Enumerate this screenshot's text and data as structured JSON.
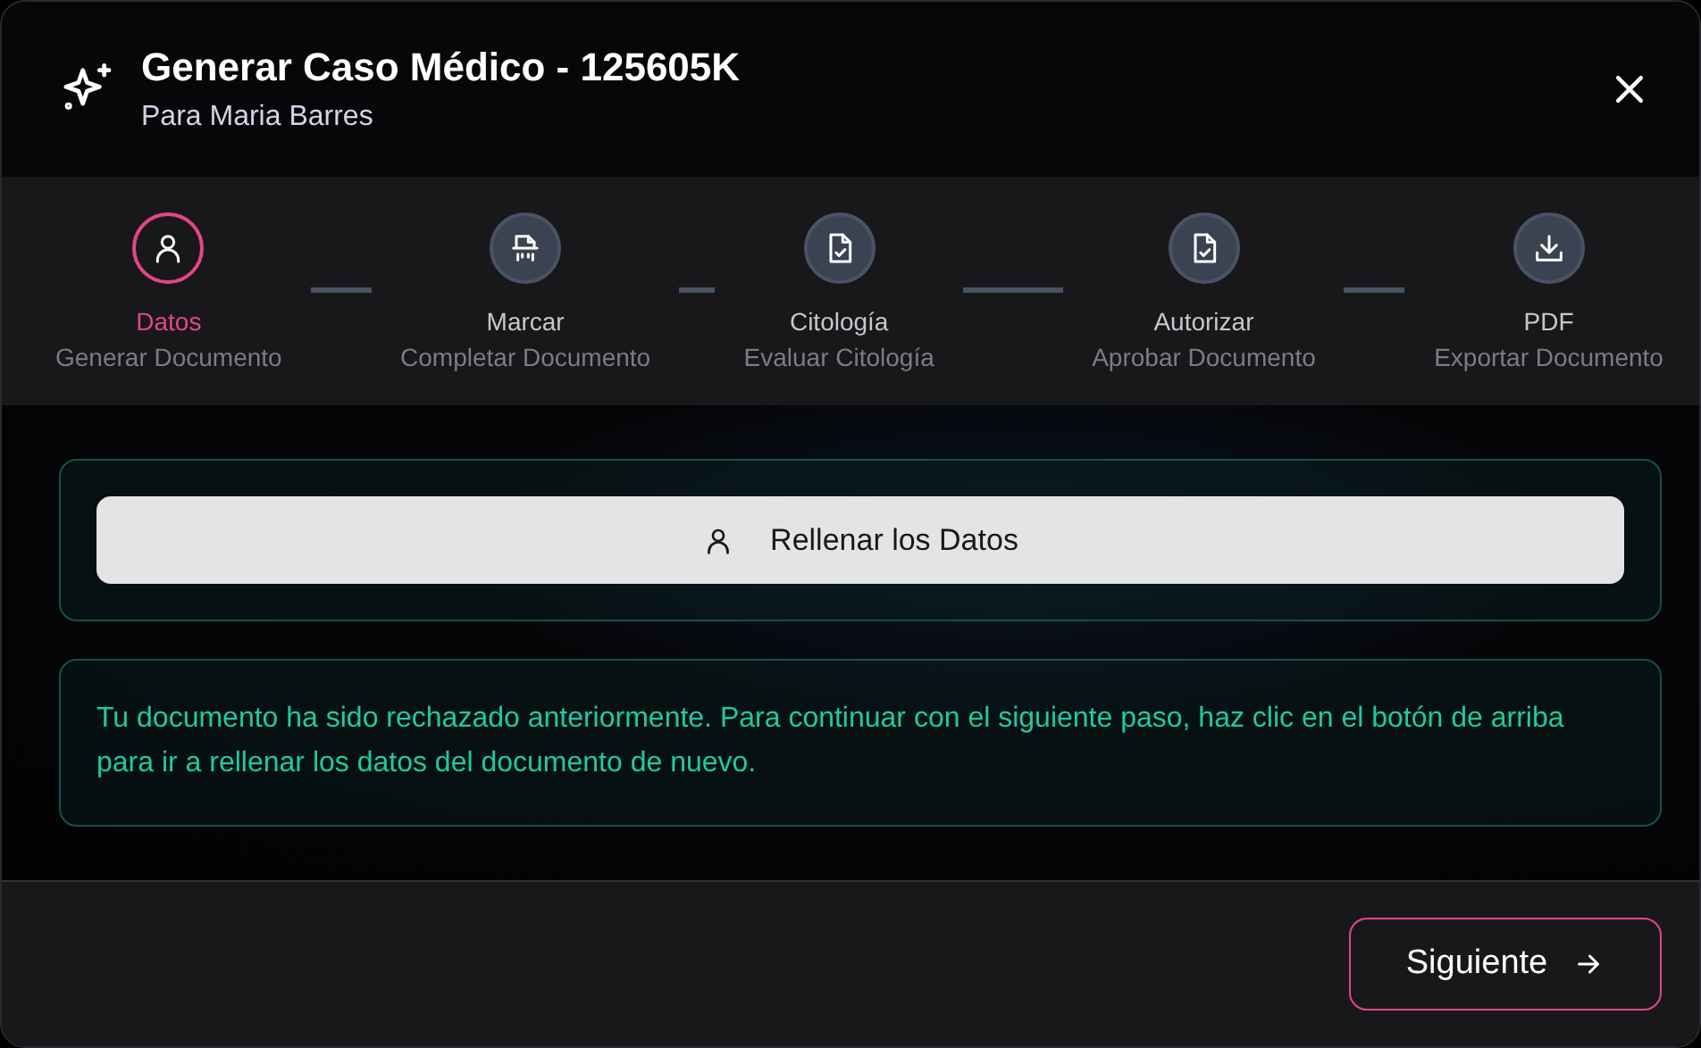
{
  "dialog": {
    "title": "Generar Caso Médico - 125605K",
    "subtitle": "Para Maria Barres"
  },
  "steps": [
    {
      "label": "Datos",
      "description": "Generar Documento",
      "selected": true
    },
    {
      "label": "Marcar",
      "description": "Completar Documento",
      "selected": false
    },
    {
      "label": "Citología",
      "description": "Evaluar Citología",
      "selected": false
    },
    {
      "label": "Autorizar",
      "description": "Aprobar Documento",
      "selected": false
    },
    {
      "label": "PDF",
      "description": "Exportar Documento",
      "selected": false
    }
  ],
  "fill_button": {
    "label": "Rellenar los Datos"
  },
  "notice": "Tu documento ha sido rechazado anteriormente. Para continuar con el siguiente paso, haz clic en el botón de arriba para ir a rellenar los datos del documento de nuevo.",
  "next_button": {
    "label": "Siguiente"
  }
}
